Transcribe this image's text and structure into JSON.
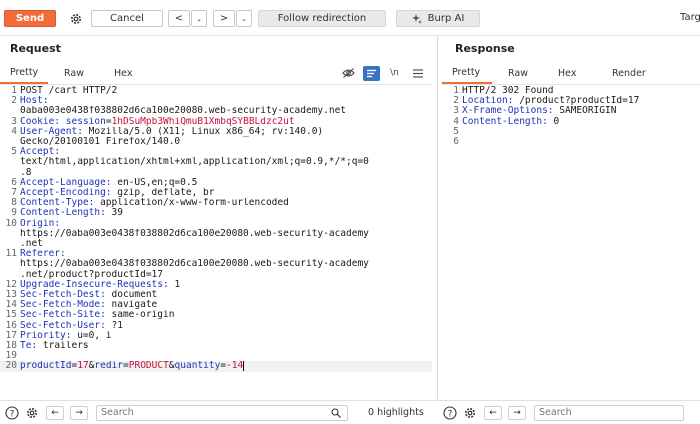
{
  "toolbar": {
    "send_label": "Send",
    "cancel_label": "Cancel",
    "back_label": "<",
    "forward_label": ">",
    "follow_label": "Follow redirection",
    "burpai_label": "Burp AI",
    "target_label": "Targ"
  },
  "request": {
    "title": "Request",
    "tabs": [
      "Pretty",
      "Raw",
      "Hex"
    ],
    "active_tab": "Pretty",
    "tools": {
      "newline_label": "\\n"
    },
    "lines": [
      {
        "n": "1",
        "text": "POST /cart HTTP/2"
      },
      {
        "n": "2",
        "name": "Host:"
      },
      {
        "n": "",
        "text": "0aba003e0438f038802d6ca100e20080.web-security-academy.net"
      },
      {
        "n": "3",
        "name": "Cookie:",
        "sep": " ",
        "cookie_name": "session",
        "cookie_eq": "=",
        "cookie_value": "1hDSuMpb3WhiQmuB1XmbqSYBBLdzc2ut"
      },
      {
        "n": "4",
        "name": "User-Agent:",
        "text": " Mozilla/5.0 (X11; Linux x86_64; rv:140.0)"
      },
      {
        "n": "",
        "text": "Gecko/20100101 Firefox/140.0"
      },
      {
        "n": "5",
        "name": "Accept:"
      },
      {
        "n": "",
        "text": "text/html,application/xhtml+xml,application/xml;q=0.9,*/*;q=0"
      },
      {
        "n": "",
        "text": ".8"
      },
      {
        "n": "6",
        "name": "Accept-Language:",
        "text": " en-US,en;q=0.5"
      },
      {
        "n": "7",
        "name": "Accept-Encoding:",
        "text": " gzip, deflate, br"
      },
      {
        "n": "8",
        "name": "Content-Type:",
        "text": " application/x-www-form-urlencoded"
      },
      {
        "n": "9",
        "name": "Content-Length:",
        "text": " 39"
      },
      {
        "n": "10",
        "name": "Origin:"
      },
      {
        "n": "",
        "text": "https://0aba003e0438f038802d6ca100e20080.web-security-academy"
      },
      {
        "n": "",
        "text": ".net"
      },
      {
        "n": "11",
        "name": "Referer:"
      },
      {
        "n": "",
        "text": "https://0aba003e0438f038802d6ca100e20080.web-security-academy"
      },
      {
        "n": "",
        "text": ".net/product?productId=17"
      },
      {
        "n": "12",
        "name": "Upgrade-Insecure-Requests:",
        "text": " 1"
      },
      {
        "n": "13",
        "name": "Sec-Fetch-Dest:",
        "text": " document"
      },
      {
        "n": "14",
        "name": "Sec-Fetch-Mode:",
        "text": " navigate"
      },
      {
        "n": "15",
        "name": "Sec-Fetch-Site:",
        "text": " same-origin"
      },
      {
        "n": "16",
        "name": "Sec-Fetch-User:",
        "text": " ?1"
      },
      {
        "n": "17",
        "name": "Priority:",
        "text": " u=0, i"
      },
      {
        "n": "18",
        "name": "Te:",
        "text": " trailers"
      },
      {
        "n": "19",
        "text": ""
      },
      {
        "n": "20",
        "body": [
          {
            "k": "productId",
            "v": "17"
          },
          {
            "k": "redir",
            "v": "PRODUCT"
          },
          {
            "k": "quantity",
            "v": "-14"
          }
        ],
        "amp": "&",
        "eq": "="
      }
    ],
    "search_placeholder": "Search",
    "highlights": "0 highlights"
  },
  "response": {
    "title": "Response",
    "tabs": [
      "Pretty",
      "Raw",
      "Hex",
      "Render"
    ],
    "active_tab": "Pretty",
    "lines": [
      {
        "n": "1",
        "text": "HTTP/2 302 Found"
      },
      {
        "n": "2",
        "name": "Location:",
        "text": " /product?productId=17"
      },
      {
        "n": "3",
        "name": "X-Frame-Options:",
        "text": " SAMEORIGIN"
      },
      {
        "n": "4",
        "name": "Content-Length:",
        "text": " 0"
      },
      {
        "n": "5",
        "text": ""
      },
      {
        "n": "6",
        "text": ""
      }
    ],
    "search_placeholder": "Search"
  },
  "colors": {
    "accent": "#f26b3a",
    "header_name": "#1d34b8",
    "value_highlight": "#c4123c"
  }
}
